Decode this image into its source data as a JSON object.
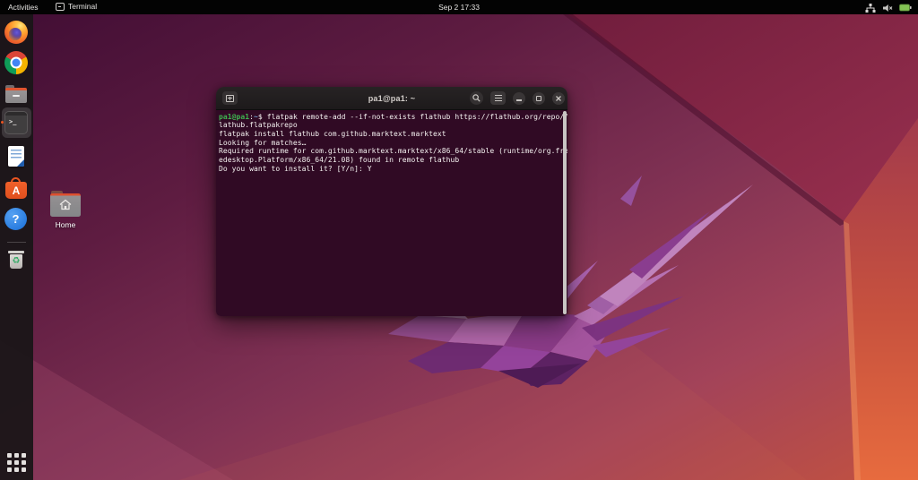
{
  "topbar": {
    "activities_label": "Activities",
    "focused_app_label": "Terminal",
    "clock": "Sep 2 17:33",
    "status_icons": [
      "wired-network-icon",
      "volume-muted-icon",
      "battery-icon"
    ]
  },
  "dock": {
    "items": [
      "firefox",
      "chrome",
      "files",
      "terminal",
      "libreoffice-writer",
      "ubuntu-software",
      "help",
      "trash"
    ],
    "active_item": "terminal"
  },
  "desktop": {
    "home_icon_label": "Home"
  },
  "terminal_window": {
    "title": "pa1@pa1: ~",
    "prompt": {
      "user_host": "pa1@pa1",
      "separator": ":",
      "path": "~",
      "symbol": "$ "
    },
    "command_line_1": "flatpak remote-add --if-not-exists flathub https://flathub.org/repo/f",
    "output_lines": [
      "lathub.flatpakrepo",
      "flatpak install flathub com.github.marktext.marktext",
      "Looking for matches…",
      "Required runtime for com.github.marktext.marktext/x86_64/stable (runtime/org.fre",
      "edesktop.Platform/x86_64/21.08) found in remote flathub",
      "Do you want to install it? [Y/n]: Y"
    ]
  },
  "icons": {
    "terminal_prompt_glyph": ">_",
    "software_letter": "A",
    "help_glyph": "?",
    "trash_glyph": "♻"
  },
  "colors": {
    "accent_orange": "#E95420",
    "terminal_bg": "#300A24",
    "prompt_green": "#3EB34F",
    "path_blue": "#729FCF",
    "battery_green": "#84C454"
  }
}
